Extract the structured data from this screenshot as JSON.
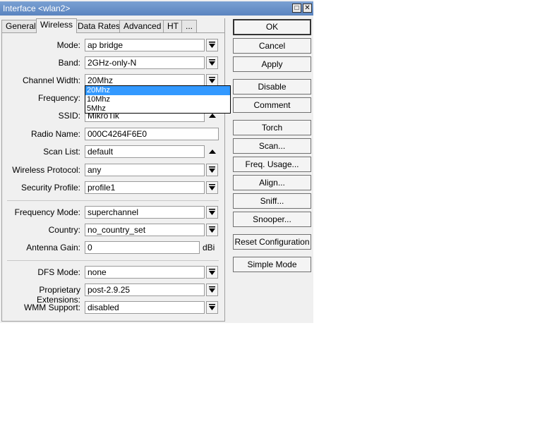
{
  "window": {
    "title": "Interface <wlan2>",
    "maximize_glyph": "□",
    "close_glyph": "✕"
  },
  "tabs": [
    {
      "label": "General"
    },
    {
      "label": "Wireless"
    },
    {
      "label": "Data Rates"
    },
    {
      "label": "Advanced"
    },
    {
      "label": "HT"
    },
    {
      "label": "..."
    }
  ],
  "fields": {
    "mode": {
      "label": "Mode:",
      "value": "ap bridge"
    },
    "band": {
      "label": "Band:",
      "value": "2GHz-only-N"
    },
    "channel_width": {
      "label": "Channel Width:",
      "value": "20Mhz"
    },
    "frequency": {
      "label": "Frequency:",
      "value": ""
    },
    "ssid": {
      "label": "SSID:",
      "value": "MikroTik"
    },
    "radio_name": {
      "label": "Radio Name:",
      "value": "000C4264F6E0"
    },
    "scan_list": {
      "label": "Scan List:",
      "value": "default"
    },
    "wireless_protocol": {
      "label": "Wireless Protocol:",
      "value": "any"
    },
    "security_profile": {
      "label": "Security Profile:",
      "value": "profile1"
    },
    "frequency_mode": {
      "label": "Frequency Mode:",
      "value": "superchannel"
    },
    "country": {
      "label": "Country:",
      "value": "no_country_set"
    },
    "antenna_gain": {
      "label": "Antenna Gain:",
      "value": "0",
      "unit": "dBi"
    },
    "dfs_mode": {
      "label": "DFS Mode:",
      "value": "none"
    },
    "proprietary_extensions": {
      "label": "Proprietary Extensions:",
      "value": "post-2.9.25"
    },
    "wmm_support": {
      "label": "WMM Support:",
      "value": "disabled"
    }
  },
  "channel_width_options": [
    "20Mhz",
    "10Mhz",
    "5Mhz"
  ],
  "buttons": {
    "ok": "OK",
    "cancel": "Cancel",
    "apply": "Apply",
    "disable": "Disable",
    "comment": "Comment",
    "torch": "Torch",
    "scan": "Scan...",
    "freq_usage": "Freq. Usage...",
    "align": "Align...",
    "sniff": "Sniff...",
    "snooper": "Snooper...",
    "reset_configuration": "Reset Configuration",
    "simple_mode": "Simple Mode"
  },
  "colors": {
    "titlebar": "#6a92cb",
    "selection": "#3399ff"
  },
  "icons": {
    "dropdown": "dropdown-arrow-icon",
    "up": "up-arrow-icon"
  }
}
